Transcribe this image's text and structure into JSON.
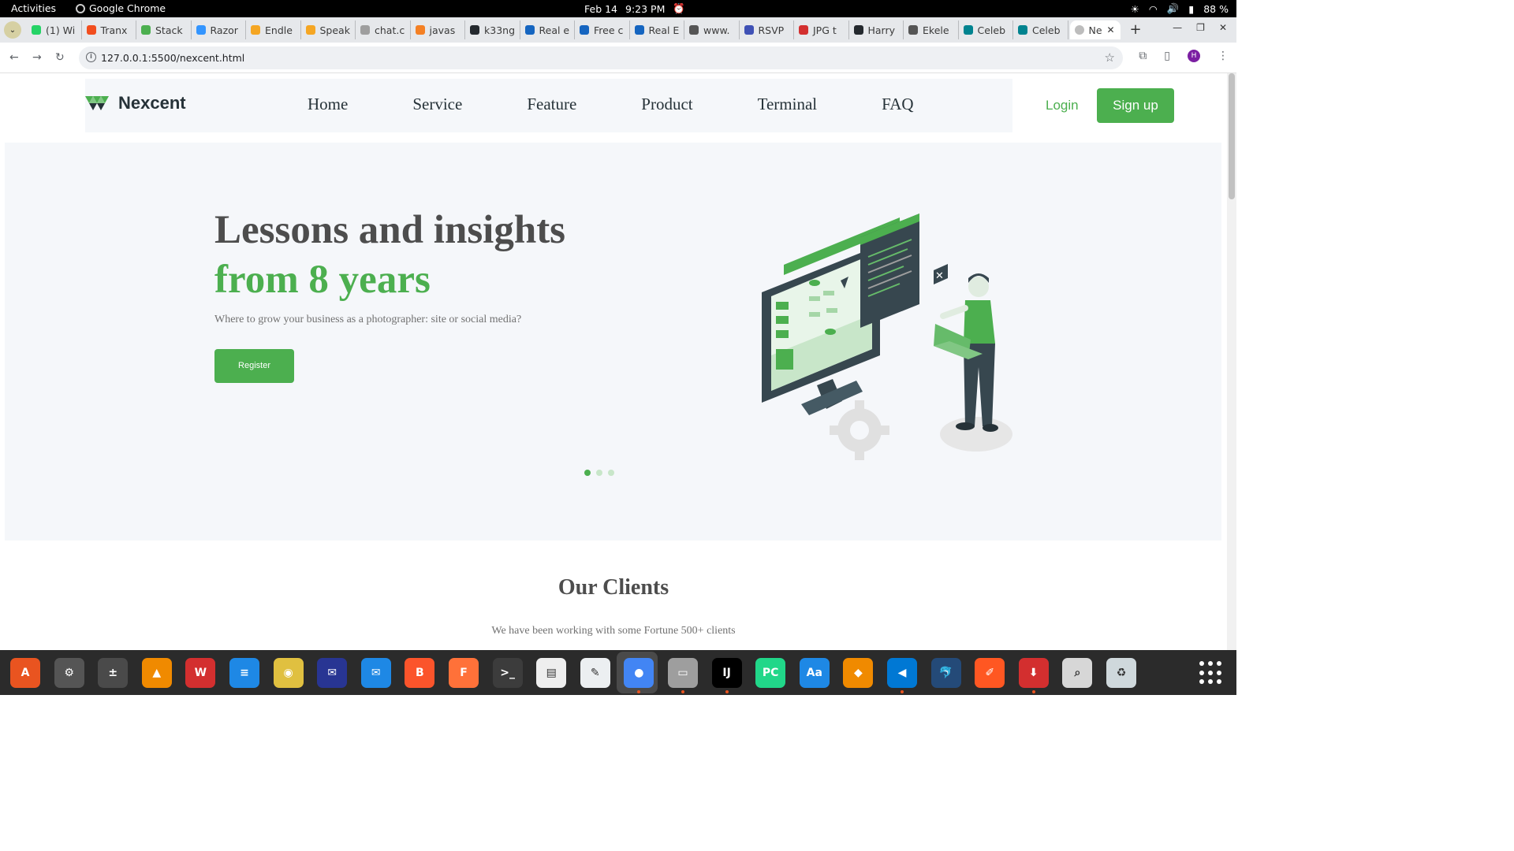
{
  "system": {
    "activities": "Activities",
    "app_name": "Google Chrome",
    "date": "Feb 14",
    "time": "9:23 PM",
    "battery": "88 %"
  },
  "browser": {
    "tabs": [
      {
        "label": "(1) Wi",
        "color": "#25d366"
      },
      {
        "label": "Tranx",
        "color": "#f24e1e"
      },
      {
        "label": "Stack",
        "color": "#4caf4f"
      },
      {
        "label": "Razor",
        "color": "#3395ff"
      },
      {
        "label": "Endle",
        "color": "#f5a623"
      },
      {
        "label": "Speak",
        "color": "#f5a623"
      },
      {
        "label": "chat.c",
        "color": "#9e9e9e"
      },
      {
        "label": "javas",
        "color": "#f48024"
      },
      {
        "label": "k33ng",
        "color": "#24292e"
      },
      {
        "label": "Real e",
        "color": "#1565c0"
      },
      {
        "label": "Free c",
        "color": "#1565c0"
      },
      {
        "label": "Real E",
        "color": "#1565c0"
      },
      {
        "label": "www.",
        "color": "#555555"
      },
      {
        "label": "RSVP",
        "color": "#3f51b5"
      },
      {
        "label": "JPG t",
        "color": "#d32f2f"
      },
      {
        "label": "Harry",
        "color": "#24292e"
      },
      {
        "label": "Ekele",
        "color": "#555555"
      },
      {
        "label": "Celeb",
        "color": "#00838f"
      },
      {
        "label": "Celeb",
        "color": "#00838f"
      }
    ],
    "active_tab": {
      "label": "Ne",
      "close": "✕"
    },
    "new_tab": "+",
    "url": "127.0.0.1:5500/nexcent.html",
    "avatar_letter": "H"
  },
  "page": {
    "brand": "Nexcent",
    "nav": [
      "Home",
      "Service",
      "Feature",
      "Product",
      "Terminal",
      "FAQ"
    ],
    "login": "Login",
    "signup": "Sign up",
    "hero": {
      "title_line1": "Lessons and insights",
      "title_line2": "from 8 years",
      "subtitle": "Where to grow your business as a photographer: site or social media?",
      "cta": "Register",
      "slide_index": 1,
      "slide_count": 3
    },
    "clients": {
      "title": "Our Clients",
      "subtitle": "We have been working with some Fortune 500+ clients"
    },
    "colors": {
      "accent": "#4caf4f",
      "heading": "#4d4d4d",
      "body": "#717171",
      "hero_bg": "#f5f7fa"
    }
  },
  "dock": {
    "apps": [
      {
        "name": "app-center",
        "label": "A",
        "color": "#e95420"
      },
      {
        "name": "settings",
        "label": "⚙",
        "color": "#555555"
      },
      {
        "name": "calculator",
        "label": "±",
        "color": "#4a4a4a"
      },
      {
        "name": "vlc",
        "label": "▲",
        "color": "#f08a00"
      },
      {
        "name": "wps-office",
        "label": "W",
        "color": "#d32f2f"
      },
      {
        "name": "text-document",
        "label": "≡",
        "color": "#1e88e5"
      },
      {
        "name": "rhythmbox",
        "label": "◉",
        "color": "#e0c040"
      },
      {
        "name": "mail",
        "label": "✉",
        "color": "#283593"
      },
      {
        "name": "thunderbird",
        "label": "✉",
        "color": "#1e88e5"
      },
      {
        "name": "brave",
        "label": "B",
        "color": "#fb542b"
      },
      {
        "name": "firefox",
        "label": "F",
        "color": "#ff7139"
      },
      {
        "name": "terminal",
        "label": ">_",
        "color": "#3c3c3c"
      },
      {
        "name": "document-viewer",
        "label": "▤",
        "color": "#eeeeee"
      },
      {
        "name": "text-editor",
        "label": "✎",
        "color": "#eceff1"
      },
      {
        "name": "chrome",
        "label": "●",
        "color": "#4285f4"
      },
      {
        "name": "files",
        "label": "▭",
        "color": "#9e9e9e"
      },
      {
        "name": "intellij",
        "label": "IJ",
        "color": "#000000"
      },
      {
        "name": "pycharm",
        "label": "PC",
        "color": "#21d789"
      },
      {
        "name": "dictionary",
        "label": "Aa",
        "color": "#1e88e5"
      },
      {
        "name": "draw-app",
        "label": "◆",
        "color": "#f08a00"
      },
      {
        "name": "vscode",
        "label": "◀",
        "color": "#0078d4"
      },
      {
        "name": "mysql-workbench",
        "label": "🐬",
        "color": "#244a78"
      },
      {
        "name": "pen-tool",
        "label": "✐",
        "color": "#ff5722"
      },
      {
        "name": "downloader",
        "label": "⬇",
        "color": "#d32f2f"
      },
      {
        "name": "screenshot-viewer",
        "label": "⌕",
        "color": "#d7d7d7"
      },
      {
        "name": "trash",
        "label": "♻",
        "color": "#cfd8dc"
      }
    ]
  }
}
